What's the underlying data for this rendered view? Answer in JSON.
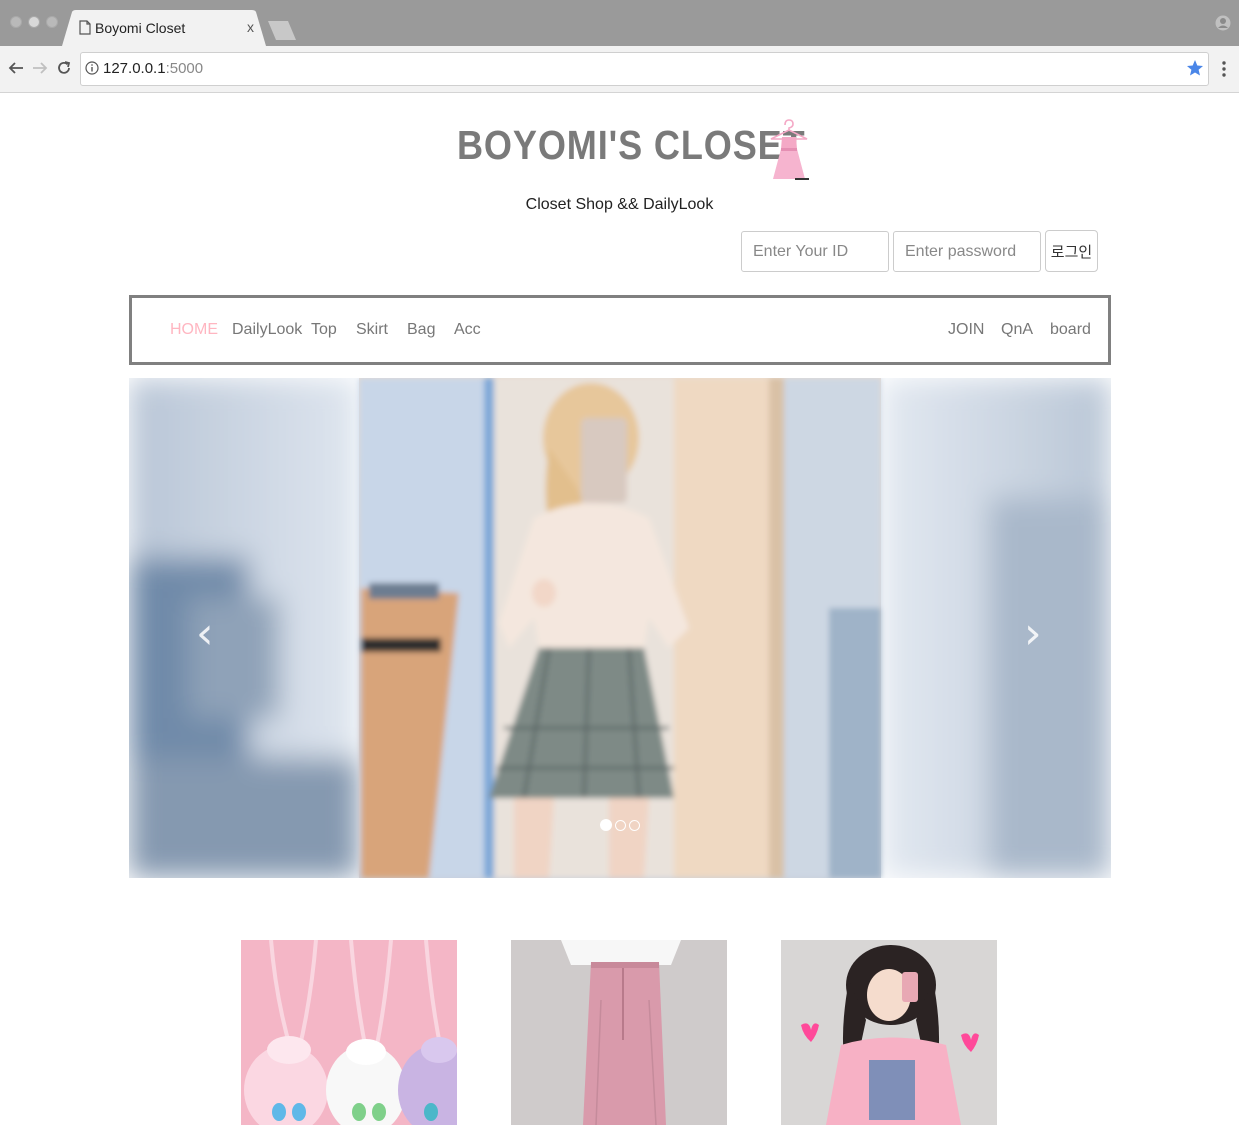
{
  "browser": {
    "tab_title": "Boyomi Closet",
    "tab_close": "x",
    "url_host": "127.0.0.1",
    "url_port": ":5000",
    "icons": [
      "back-icon",
      "forward-icon",
      "reload-icon",
      "info-icon",
      "star-icon",
      "menu-icon",
      "profile-icon",
      "page-icon"
    ]
  },
  "header": {
    "logo_text": "BOYOMI'S CLOSET",
    "subtitle": "Closet Shop && DailyLook"
  },
  "login": {
    "id_placeholder": "Enter Your ID",
    "password_placeholder": "Enter password",
    "button_label": "로그인"
  },
  "nav": {
    "left": [
      "HOME",
      "DailyLook",
      "Top",
      "Skirt",
      "Bag",
      "Acc"
    ],
    "right": [
      "JOIN",
      "QnA",
      "board"
    ],
    "active": "HOME",
    "active_color": "#ffb6c1"
  },
  "carousel": {
    "prev": "‹",
    "next": "›",
    "slide_count": 3,
    "active_slide": 1
  },
  "colors": {
    "accent_pink": "#ffb6c1",
    "border_gray": "#808080",
    "logo_gray": "#7a7a7a"
  }
}
